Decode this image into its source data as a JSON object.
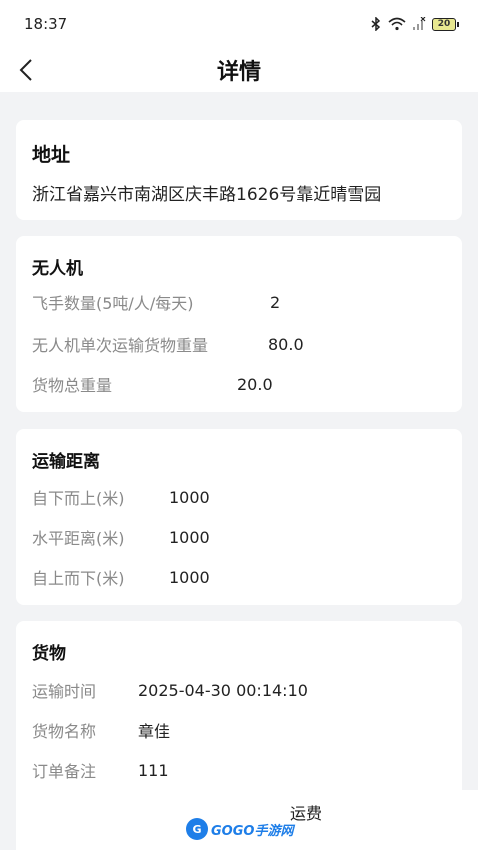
{
  "status_bar": {
    "time": "18:37",
    "battery": "20"
  },
  "header": {
    "title": "详情"
  },
  "address": {
    "title": "地址",
    "text": "浙江省嘉兴市南湖区庆丰路1626号靠近晴雪园"
  },
  "drone": {
    "title": "无人机",
    "rows": [
      {
        "label": "飞手数量(5吨/人/每天)",
        "value": "2"
      },
      {
        "label": "无人机单次运输货物重量",
        "value": "80.0"
      },
      {
        "label": "货物总重量",
        "value": "20.0"
      }
    ]
  },
  "distance": {
    "title": "运输距离",
    "rows": [
      {
        "label": "自下而上(米)",
        "value": "1000"
      },
      {
        "label": "水平距离(米)",
        "value": "1000"
      },
      {
        "label": "自上而下(米)",
        "value": "1000"
      }
    ]
  },
  "cargo": {
    "title": "货物",
    "rows": [
      {
        "label": "运输时间",
        "value": "2025-04-30 00:14:10"
      },
      {
        "label": "货物名称",
        "value": "章佳"
      },
      {
        "label": "订单备注",
        "value": "111"
      }
    ]
  },
  "bottom": {
    "button_partial": "运费",
    "watermark": "GOGO手游网"
  },
  "colors": {
    "accent": "#1e7ee8",
    "background": "#f2f3f5"
  },
  "icons": {
    "back": "chevron-left-icon",
    "bluetooth": "bluetooth-icon",
    "wifi": "wifi-icon",
    "signal": "signal-icon",
    "battery": "battery-icon"
  }
}
